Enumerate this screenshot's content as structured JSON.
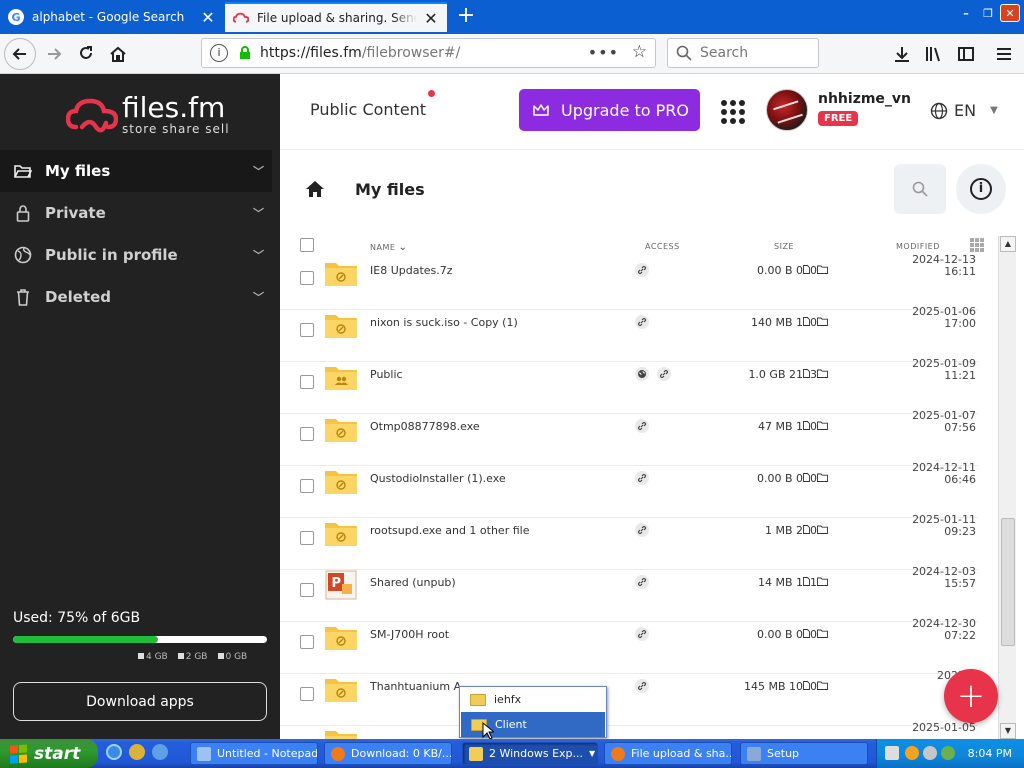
{
  "browser": {
    "tabs": [
      {
        "title": "alphabet - Google Search",
        "favicon": "G"
      },
      {
        "title": "File upload & sharing. Send large p"
      }
    ],
    "url_host": "https://files.fm",
    "url_path": "/filebrowser#/",
    "search_placeholder": "Search"
  },
  "site": {
    "brand": "files.fm",
    "tagline": "store  share  sell",
    "accent_color": "#e8344b",
    "upgrade_color": "#8c2be0"
  },
  "sidebar": {
    "items": [
      {
        "label": "My files",
        "icon": "folder-open-icon"
      },
      {
        "label": "Private",
        "icon": "lock-icon"
      },
      {
        "label": "Public in profile",
        "icon": "globe-icon"
      },
      {
        "label": "Deleted",
        "icon": "trash-icon"
      }
    ],
    "usage_label": "Used: 75% of 6GB",
    "usage_fraction": 0.75,
    "legend": [
      "4 GB",
      "2 GB",
      "0 GB"
    ],
    "download_apps": "Download apps"
  },
  "header": {
    "public_content": "Public Content",
    "upgrade": "Upgrade to PRO",
    "username": "nhhizme_vn",
    "plan_badge": "FREE",
    "language": "EN"
  },
  "main": {
    "title": "My files",
    "columns": {
      "name": "NAME",
      "access": "ACCESS",
      "size": "SIZE",
      "modified": "MODIFIED"
    }
  },
  "files": [
    {
      "name": "IE8 Updates.7z",
      "size": "0.00  B 0",
      "files": "0",
      "icon": "folder",
      "public": false,
      "date": "2024-12-13",
      "time": "16:11"
    },
    {
      "name": "nixon is suck.iso - Copy (1)",
      "size": "140 MB 1",
      "files": "0",
      "icon": "folder",
      "public": false,
      "date": "2025-01-06",
      "time": "17:00"
    },
    {
      "name": "Public",
      "size": "1.0 GB 21",
      "files": "3",
      "icon": "folder-users",
      "public": true,
      "date": "2025-01-09",
      "time": "11:21"
    },
    {
      "name": "Otmp08877898.exe",
      "size": "47 MB 1",
      "files": "0",
      "icon": "folder",
      "public": false,
      "date": "2025-01-07",
      "time": "07:56"
    },
    {
      "name": "QustodioInstaller (1).exe",
      "size": "0.00  B 0",
      "files": "0",
      "icon": "folder",
      "public": false,
      "date": "2024-12-11",
      "time": "06:46"
    },
    {
      "name": "rootsupd.exe and 1 other file",
      "size": "1 MB 2",
      "files": "0",
      "icon": "folder",
      "public": false,
      "date": "2025-01-11",
      "time": "09:23"
    },
    {
      "name": "Shared (unpub)",
      "size": "14 MB 1",
      "files": "1",
      "icon": "powerpoint",
      "public": false,
      "date": "2024-12-03",
      "time": "15:57"
    },
    {
      "name": "SM-J700H root",
      "size": "0.00  B 0",
      "files": "0",
      "icon": "folder",
      "public": false,
      "date": "2024-12-30",
      "time": "07:22"
    },
    {
      "name": "Thanhtuanium A",
      "size": "145 MB 10",
      "files": "0",
      "icon": "folder",
      "public": false,
      "date": "2025-0",
      "time": ""
    },
    {
      "name": "",
      "size": "",
      "files": "",
      "icon": "folder",
      "public": false,
      "date": "2025-01-05",
      "time": ""
    }
  ],
  "popup": {
    "items": [
      "iehfx",
      "Client"
    ]
  },
  "taskbar": {
    "start": "start",
    "buttons": [
      {
        "label": "Untitled - Notepad"
      },
      {
        "label": "Download: 0 KB/..."
      },
      {
        "label": "2 Windows Exp..."
      },
      {
        "label": "File upload & sha..."
      },
      {
        "label": "Setup"
      }
    ],
    "clock": "8:04 PM"
  }
}
